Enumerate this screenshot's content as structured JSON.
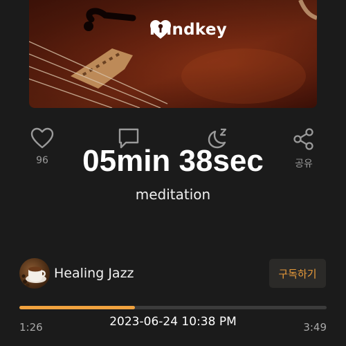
{
  "cover": {
    "logo_text": "mindkey",
    "logo_icon": "mindkey-logo-icon"
  },
  "actions": {
    "like": {
      "icon": "heart-icon",
      "label": "96"
    },
    "comment": {
      "icon": "comment-icon",
      "label": ""
    },
    "sleep": {
      "icon": "moon-sleep-icon",
      "label": ""
    },
    "share": {
      "icon": "share-icon",
      "label": "공유"
    }
  },
  "overlay": {
    "timer_text": "05min 38sec",
    "category": "meditation"
  },
  "channel": {
    "name": "Healing Jazz",
    "subscribe_label": "구독하기"
  },
  "player": {
    "current_time": "1:26",
    "total_time": "3:49",
    "progress": 0.377,
    "accent_color": "#f0a23e"
  },
  "timestamp": "2023-06-24 10:38 PM"
}
